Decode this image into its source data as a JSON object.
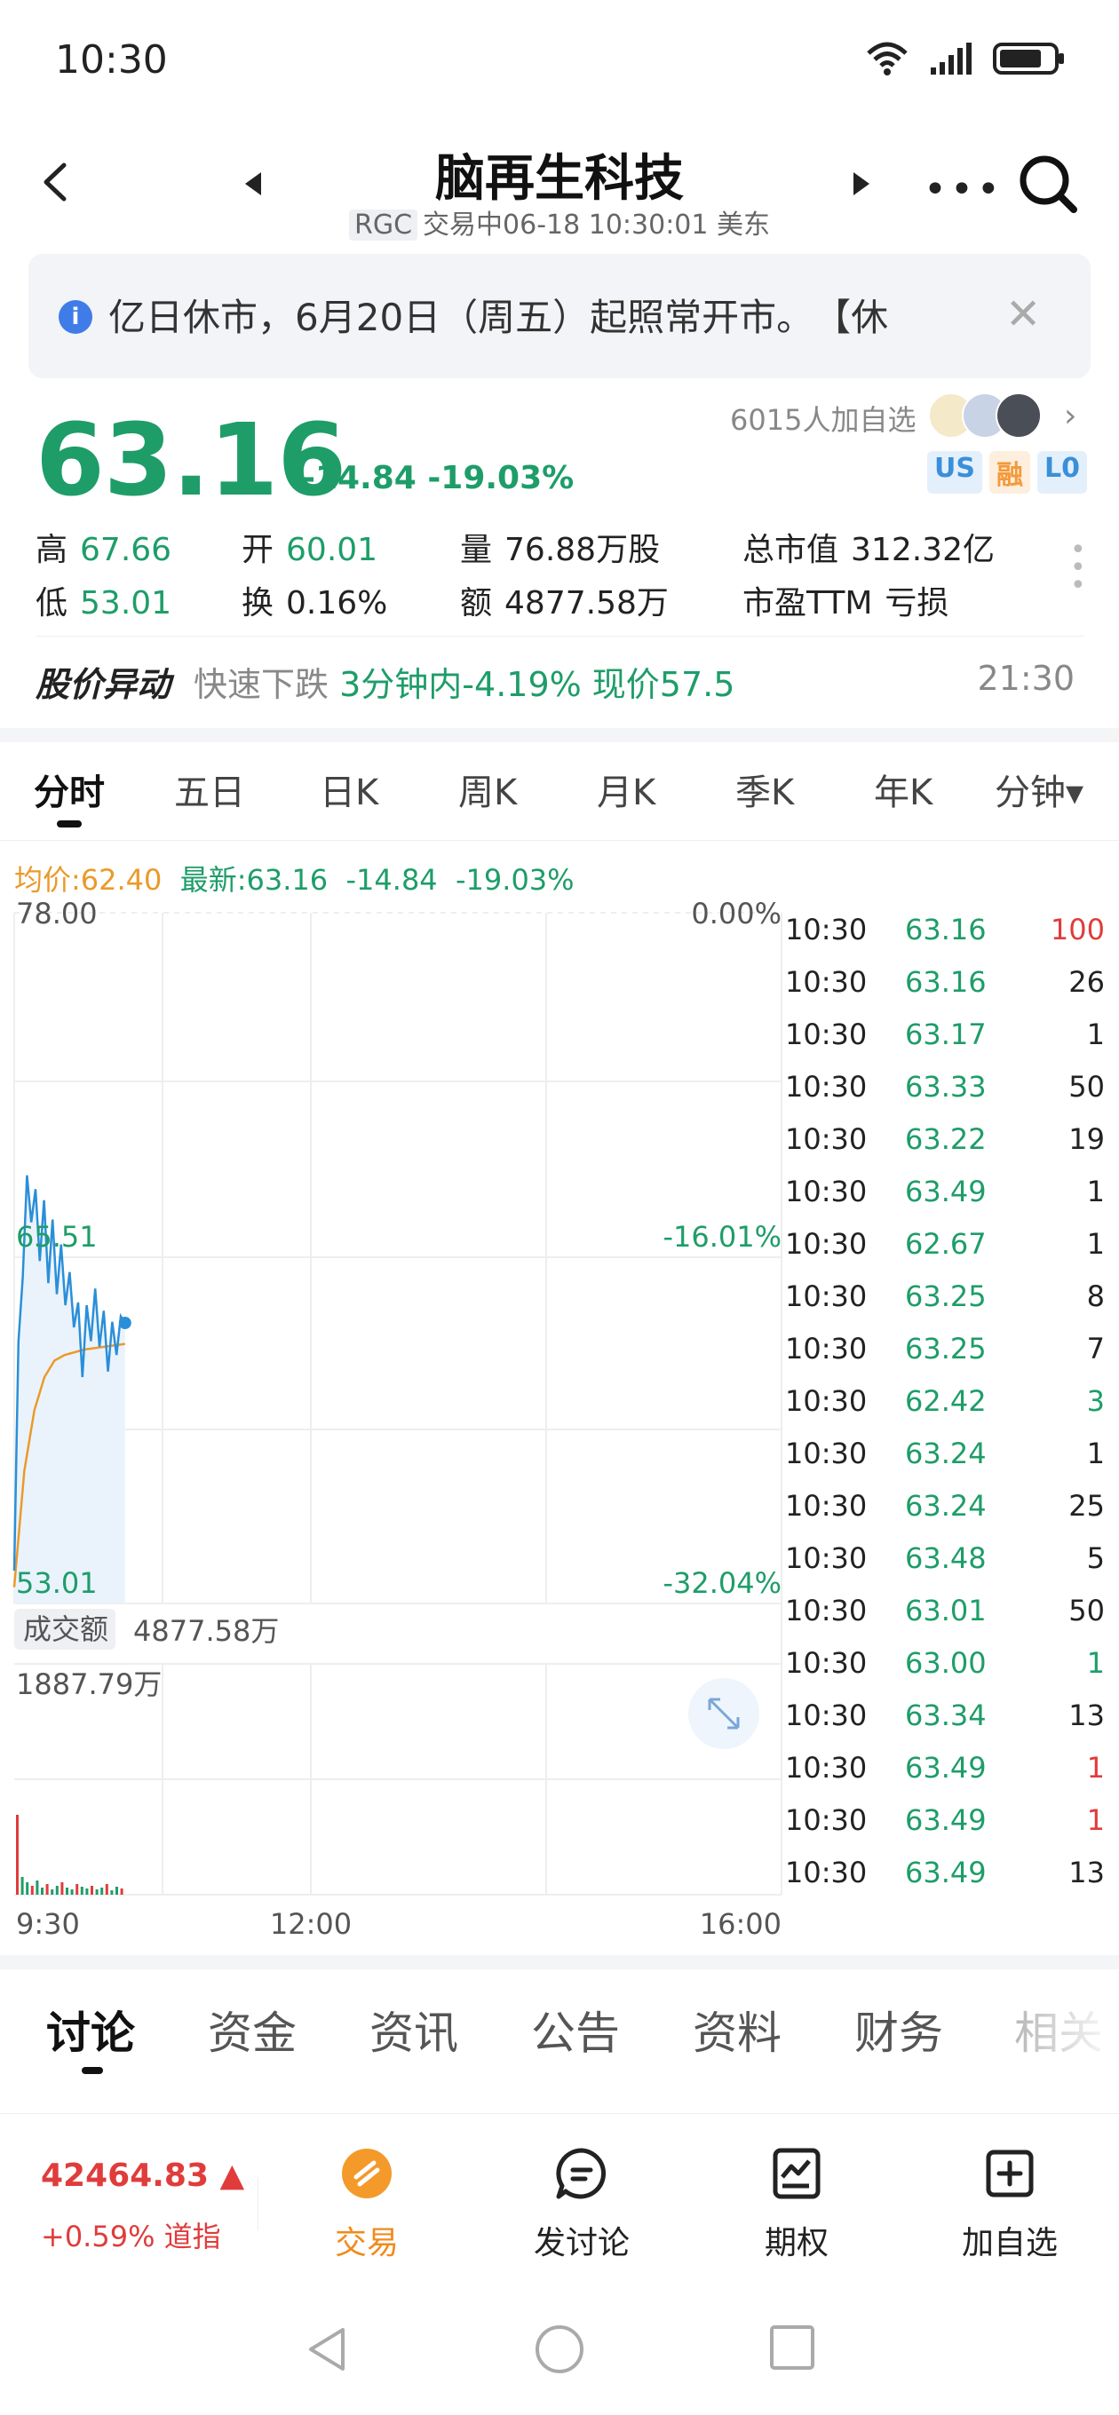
{
  "status_bar": {
    "time": "10:30"
  },
  "header": {
    "title": "脑再生科技",
    "ticker": "RGC",
    "subtitle": "交易中06-18 10:30:01 美东"
  },
  "notice": {
    "text": "亿日休市，6月20日（周五）起照常开市。　【休"
  },
  "quote": {
    "price": "63.16",
    "change": "-14.84 -19.03%",
    "watchers": "6015人加自选",
    "badges": [
      "US",
      "融",
      "L0"
    ],
    "stats": [
      {
        "label": "高",
        "value": "67.66",
        "color": "green"
      },
      {
        "label": "开",
        "value": "60.01",
        "color": "green"
      },
      {
        "label": "量",
        "value": "76.88万股",
        "color": "dark"
      },
      {
        "label": "总市值",
        "value": "312.32亿",
        "color": "dark"
      },
      {
        "label": "低",
        "value": "53.01",
        "color": "green"
      },
      {
        "label": "换",
        "value": "0.16%",
        "color": "dark"
      },
      {
        "label": "额",
        "value": "4877.58万",
        "color": "dark"
      },
      {
        "label": "市盈TTM",
        "value": "亏损",
        "color": "dark"
      }
    ]
  },
  "alert": {
    "title": "股价异动",
    "type": "快速下跌",
    "detail": "3分钟内-4.19% 现价57.5",
    "time": "21:30"
  },
  "chart_tabs": [
    "分时",
    "五日",
    "日K",
    "周K",
    "月K",
    "季K",
    "年K",
    "分钟▾"
  ],
  "avg_line": {
    "avg": "均价:62.40",
    "latest": "最新:63.16",
    "change": "-14.84",
    "pct": "-19.03%"
  },
  "chart": {
    "y_top": "78.00",
    "y_mid": "65.51",
    "y_bottom": "53.01",
    "pct_top": "0.00%",
    "pct_mid": "-16.01%",
    "pct_bottom": "-32.04%",
    "volume_label": "成交额",
    "volume_value": "4877.58万",
    "volume_max": "1887.79万",
    "x_labels": [
      "9:30",
      "12:00",
      "16:00"
    ]
  },
  "chart_data": {
    "type": "line",
    "title": "",
    "xlabel": "",
    "ylabel": "",
    "x_range": [
      "9:30",
      "16:00"
    ],
    "ylim": [
      53.01,
      78.0
    ],
    "series": [
      {
        "name": "最新",
        "values": [
          54.2,
          62.5,
          64.8,
          68.5,
          66.8,
          68.0,
          65.4,
          67.6,
          64.6,
          66.9,
          64.2,
          66.0,
          63.8,
          65.0,
          63.0,
          63.9,
          61.2,
          63.8,
          62.5,
          64.4,
          62.3,
          63.6,
          61.4,
          63.2,
          62.0,
          63.4,
          63.16
        ]
      },
      {
        "name": "均价",
        "values": [
          53.6,
          57.8,
          60.0,
          61.2,
          61.8,
          62.0,
          62.1,
          62.2,
          62.25,
          62.3,
          62.35,
          62.4
        ]
      }
    ]
  },
  "ticks": [
    {
      "time": "10:30",
      "price": "63.16",
      "vol": "100",
      "vol_color": "red"
    },
    {
      "time": "10:30",
      "price": "63.16",
      "vol": "26",
      "vol_color": "dark"
    },
    {
      "time": "10:30",
      "price": "63.17",
      "vol": "1",
      "vol_color": "dark"
    },
    {
      "time": "10:30",
      "price": "63.33",
      "vol": "50",
      "vol_color": "dark"
    },
    {
      "time": "10:30",
      "price": "63.22",
      "vol": "19",
      "vol_color": "dark"
    },
    {
      "time": "10:30",
      "price": "63.49",
      "vol": "1",
      "vol_color": "dark"
    },
    {
      "time": "10:30",
      "price": "62.67",
      "vol": "1",
      "vol_color": "dark"
    },
    {
      "time": "10:30",
      "price": "63.25",
      "vol": "8",
      "vol_color": "dark"
    },
    {
      "time": "10:30",
      "price": "63.25",
      "vol": "7",
      "vol_color": "dark"
    },
    {
      "time": "10:30",
      "price": "62.42",
      "vol": "3",
      "vol_color": "green"
    },
    {
      "time": "10:30",
      "price": "63.24",
      "vol": "1",
      "vol_color": "dark"
    },
    {
      "time": "10:30",
      "price": "63.24",
      "vol": "25",
      "vol_color": "dark"
    },
    {
      "time": "10:30",
      "price": "63.48",
      "vol": "5",
      "vol_color": "dark"
    },
    {
      "time": "10:30",
      "price": "63.01",
      "vol": "50",
      "vol_color": "dark"
    },
    {
      "time": "10:30",
      "price": "63.00",
      "vol": "1",
      "vol_color": "green"
    },
    {
      "time": "10:30",
      "price": "63.34",
      "vol": "13",
      "vol_color": "dark"
    },
    {
      "time": "10:30",
      "price": "63.49",
      "vol": "1",
      "vol_color": "red"
    },
    {
      "time": "10:30",
      "price": "63.49",
      "vol": "1",
      "vol_color": "red"
    },
    {
      "time": "10:30",
      "price": "63.49",
      "vol": "13",
      "vol_color": "dark"
    }
  ],
  "bottom_tabs": [
    "讨论",
    "资金",
    "资讯",
    "公告",
    "资料",
    "财务",
    "相关"
  ],
  "bottom_nav": {
    "index_price": "42464.83 ▲",
    "index_change": "+0.59% 道指",
    "items": [
      "交易",
      "发讨论",
      "期权",
      "加自选"
    ]
  },
  "colors": {
    "up": "#e03c3c",
    "down": "#1e9d69",
    "avg": "#ea9a2a",
    "line": "#2a8fd8"
  }
}
